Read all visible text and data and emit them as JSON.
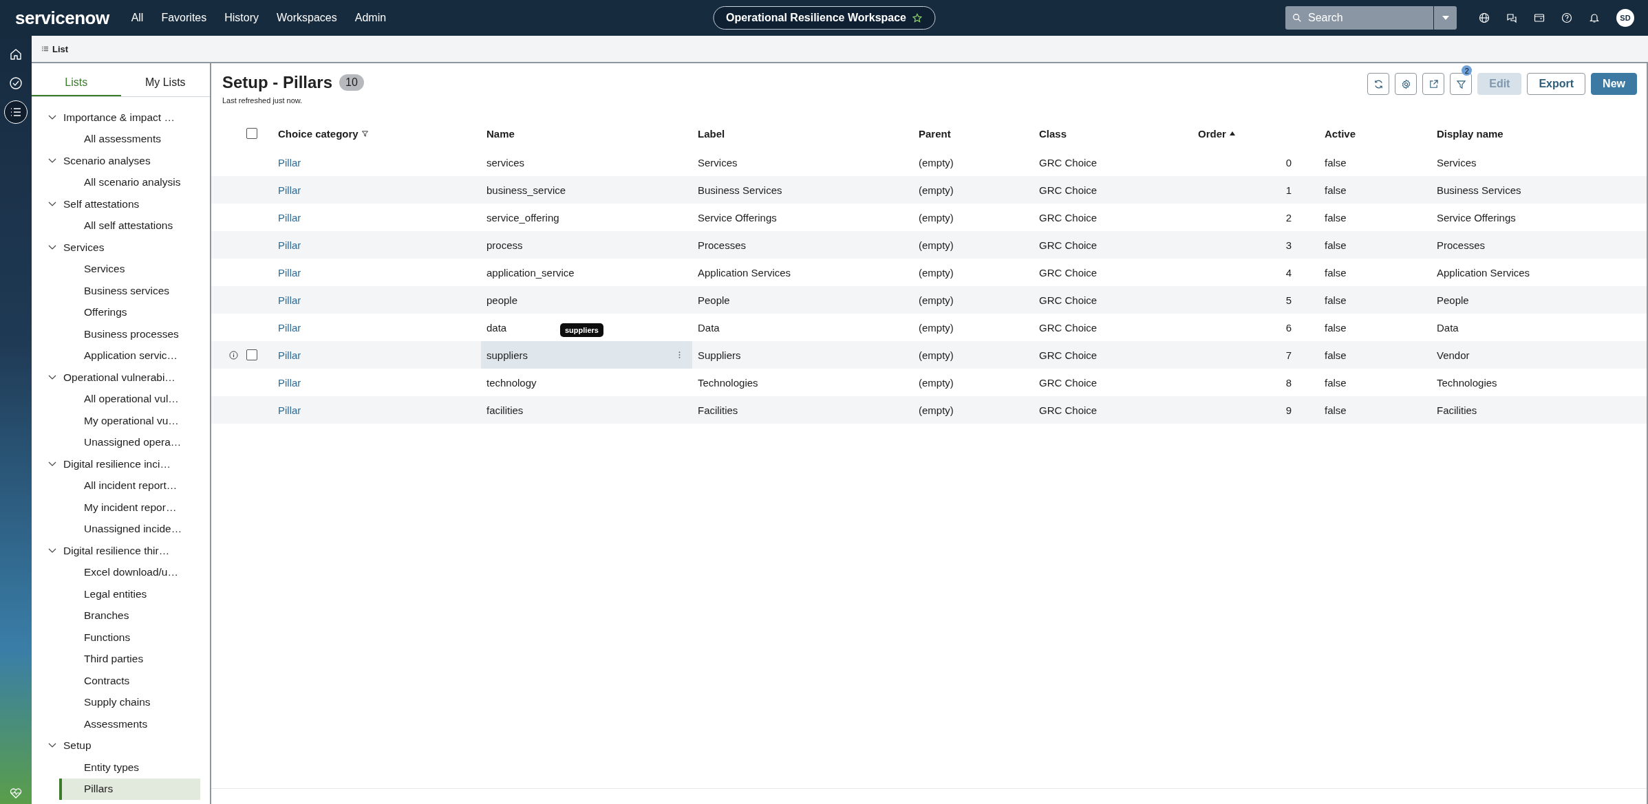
{
  "top_bar": {
    "logo": "servicenow",
    "menu": [
      {
        "label": "All"
      },
      {
        "label": "Favorites"
      },
      {
        "label": "History"
      },
      {
        "label": "Workspaces"
      },
      {
        "label": "Admin"
      }
    ],
    "workspace": "Operational Resilience Workspace",
    "search": {
      "placeholder": "Search"
    },
    "avatar": "SD"
  },
  "rail": [
    {
      "selected": false
    },
    {
      "selected": false
    },
    {
      "selected": true
    }
  ],
  "breadcrumb": "List",
  "sidebar": {
    "tabs": [
      {
        "label": "Lists",
        "selected": true
      },
      {
        "label": "My Lists",
        "selected": false
      }
    ],
    "groups": [
      {
        "label": "Importance & impact …",
        "expanded": true,
        "children": [
          {
            "label": "All assessments",
            "selected": false
          }
        ]
      },
      {
        "label": "Scenario analyses",
        "expanded": true,
        "children": [
          {
            "label": "All scenario analysis",
            "selected": false
          }
        ]
      },
      {
        "label": "Self attestations",
        "expanded": true,
        "children": [
          {
            "label": "All self attestations",
            "selected": false
          }
        ]
      },
      {
        "label": "Services",
        "expanded": true,
        "children": [
          {
            "label": "Services",
            "selected": false
          },
          {
            "label": "Business services",
            "selected": false
          },
          {
            "label": "Offerings",
            "selected": false
          },
          {
            "label": "Business processes",
            "selected": false
          },
          {
            "label": "Application servic…",
            "selected": false
          }
        ]
      },
      {
        "label": "Operational vulnerabi…",
        "expanded": true,
        "children": [
          {
            "label": "All operational vul…",
            "selected": false
          },
          {
            "label": "My operational vu…",
            "selected": false
          },
          {
            "label": "Unassigned opera…",
            "selected": false
          }
        ]
      },
      {
        "label": "Digital resilience inci…",
        "expanded": true,
        "children": [
          {
            "label": "All incident report…",
            "selected": false
          },
          {
            "label": "My incident repor…",
            "selected": false
          },
          {
            "label": "Unassigned incide…",
            "selected": false
          }
        ]
      },
      {
        "label": "Digital resilience thir…",
        "expanded": true,
        "children": [
          {
            "label": "Excel download/u…",
            "selected": false
          },
          {
            "label": "Legal entities",
            "selected": false
          },
          {
            "label": "Branches",
            "selected": false
          },
          {
            "label": "Functions",
            "selected": false
          },
          {
            "label": "Third parties",
            "selected": false
          },
          {
            "label": "Contracts",
            "selected": false
          },
          {
            "label": "Supply chains",
            "selected": false
          },
          {
            "label": "Assessments",
            "selected": false
          }
        ]
      },
      {
        "label": "Setup",
        "expanded": true,
        "children": [
          {
            "label": "Entity types",
            "selected": false
          },
          {
            "label": "Pillars",
            "selected": true
          }
        ]
      }
    ]
  },
  "list": {
    "title": "Setup - Pillars",
    "count": "10",
    "subtitle": "Last refreshed just now.",
    "actions": [
      {
        "label": "Edit",
        "disabled": true,
        "primary": false
      },
      {
        "label": "Export",
        "disabled": false,
        "primary": false
      },
      {
        "label": "New",
        "disabled": false,
        "primary": true
      }
    ],
    "filter_badge": "2",
    "select_all_checked": false,
    "columns": [
      {
        "label": "Choice category",
        "filtered": true,
        "sorted": false
      },
      {
        "label": "Name",
        "filtered": false,
        "sorted": false
      },
      {
        "label": "Label",
        "filtered": false,
        "sorted": false
      },
      {
        "label": "Parent",
        "filtered": false,
        "sorted": false
      },
      {
        "label": "Class",
        "filtered": false,
        "sorted": false
      },
      {
        "label": "Order",
        "filtered": false,
        "sorted": true
      },
      {
        "label": "Active",
        "filtered": false,
        "sorted": false
      },
      {
        "label": "Display name",
        "filtered": false,
        "sorted": false
      }
    ],
    "rows": [
      {
        "hovered": false,
        "cells": [
          "Pillar",
          "services",
          "Services",
          "(empty)",
          "GRC Choice",
          "0",
          "false",
          "Services"
        ]
      },
      {
        "hovered": false,
        "cells": [
          "Pillar",
          "business_service",
          "Business Services",
          "(empty)",
          "GRC Choice",
          "1",
          "false",
          "Business Services"
        ]
      },
      {
        "hovered": false,
        "cells": [
          "Pillar",
          "service_offering",
          "Service Offerings",
          "(empty)",
          "GRC Choice",
          "2",
          "false",
          "Service Offerings"
        ]
      },
      {
        "hovered": false,
        "cells": [
          "Pillar",
          "process",
          "Processes",
          "(empty)",
          "GRC Choice",
          "3",
          "false",
          "Processes"
        ]
      },
      {
        "hovered": false,
        "cells": [
          "Pillar",
          "application_service",
          "Application Services",
          "(empty)",
          "GRC Choice",
          "4",
          "false",
          "Application Services"
        ]
      },
      {
        "hovered": false,
        "cells": [
          "Pillar",
          "people",
          "People",
          "(empty)",
          "GRC Choice",
          "5",
          "false",
          "People"
        ]
      },
      {
        "hovered": false,
        "cells": [
          "Pillar",
          "data",
          "Data",
          "(empty)",
          "GRC Choice",
          "6",
          "false",
          "Data"
        ]
      },
      {
        "hovered": true,
        "checked": false,
        "tooltip": "suppliers",
        "cells": [
          "Pillar",
          "suppliers",
          "Suppliers",
          "(empty)",
          "GRC Choice",
          "7",
          "false",
          "Vendor"
        ]
      },
      {
        "hovered": false,
        "cells": [
          "Pillar",
          "technology",
          "Technologies",
          "(empty)",
          "GRC Choice",
          "8",
          "false",
          "Technologies"
        ]
      },
      {
        "hovered": false,
        "cells": [
          "Pillar",
          "facilities",
          "Facilities",
          "(empty)",
          "GRC Choice",
          "9",
          "false",
          "Facilities"
        ]
      }
    ]
  }
}
